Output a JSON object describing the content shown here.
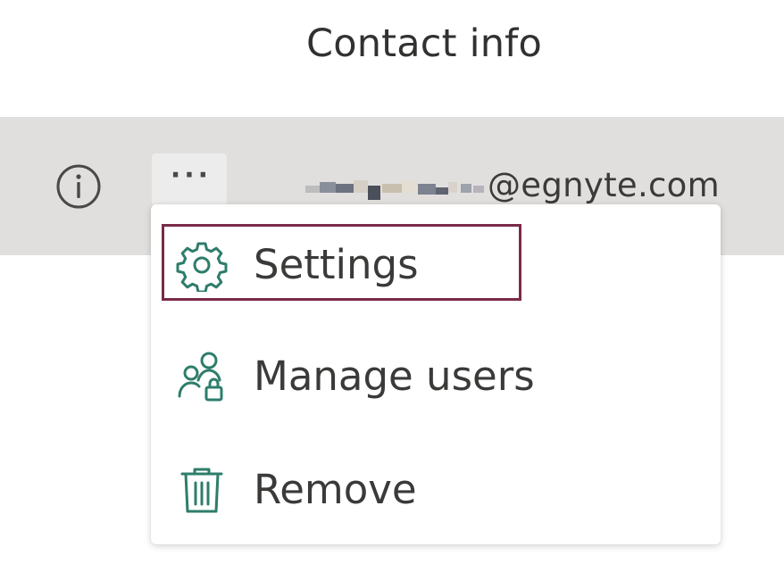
{
  "panel": {
    "title": "Contact info"
  },
  "contact_row": {
    "email_domain": "@egnyte.com",
    "more_button_label": "···"
  },
  "context_menu": {
    "items": [
      {
        "label": "Settings",
        "icon": "gear-icon",
        "focused": true
      },
      {
        "label": "Manage users",
        "icon": "manage-users-icon",
        "focused": false
      },
      {
        "label": "Remove",
        "icon": "trash-icon",
        "focused": false
      }
    ]
  },
  "colors": {
    "row_background": "#e1dfdd",
    "icon_accent": "#2e7d6b",
    "focus_outline": "#7a2a48",
    "text": "#3b3a39"
  }
}
